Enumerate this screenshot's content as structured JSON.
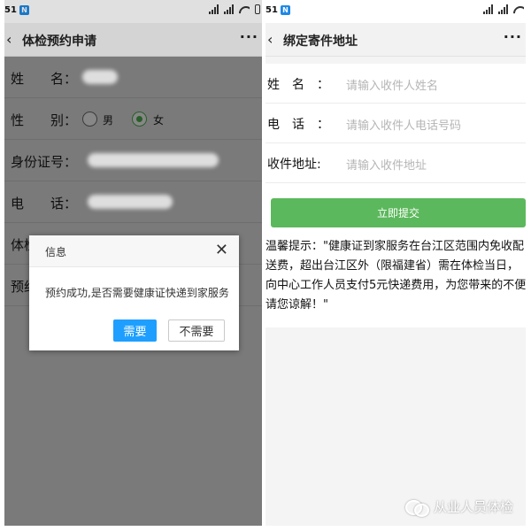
{
  "left_screen": {
    "status": {
      "carrier": "51",
      "badge": "N"
    },
    "nav": {
      "back": "‹",
      "title": "体检预约申请",
      "more": "···"
    },
    "form": {
      "name_label": "姓　　名：",
      "gender_label": "性　　别：",
      "gender_options": [
        {
          "label": "男",
          "checked": false
        },
        {
          "label": "女",
          "checked": true
        }
      ],
      "idcard_label": "身份证号：",
      "phone_label": "电　　话：",
      "row5_label": "体检",
      "row6_label": "预约"
    },
    "dialog": {
      "title": "信息",
      "close": "✕",
      "message": "预约成功,是否需要健康证快递到家服务",
      "confirm": "需要",
      "cancel": "不需要"
    }
  },
  "right_screen": {
    "status": {
      "carrier": "51",
      "badge": "N"
    },
    "nav": {
      "back": "‹",
      "title": "绑定寄件地址",
      "more": "···"
    },
    "form": {
      "name_label": "姓　名　：",
      "name_placeholder": "请输入收件人姓名",
      "phone_label": "电　话　：",
      "phone_placeholder": "请输入收件人电话号码",
      "address_label": "收件地址:",
      "address_placeholder": "请输入收件地址"
    },
    "submit": "立即提交",
    "tip_lines": [
      "温馨提示：\"健康证到家服务在台江区范围内免收配",
      "送费，超出台江区外（限福建省）需在体检当日，",
      "向中心工作人员支付5元快递费用，为您带来的不便",
      "请您谅解！\""
    ]
  },
  "watermark": {
    "text": "从业人员体检",
    "icon": "wechat-icon"
  },
  "colors": {
    "primary_button": "#1e9fff",
    "submit_button": "#5cb85c",
    "radio_checked": "#2f6d2f"
  }
}
